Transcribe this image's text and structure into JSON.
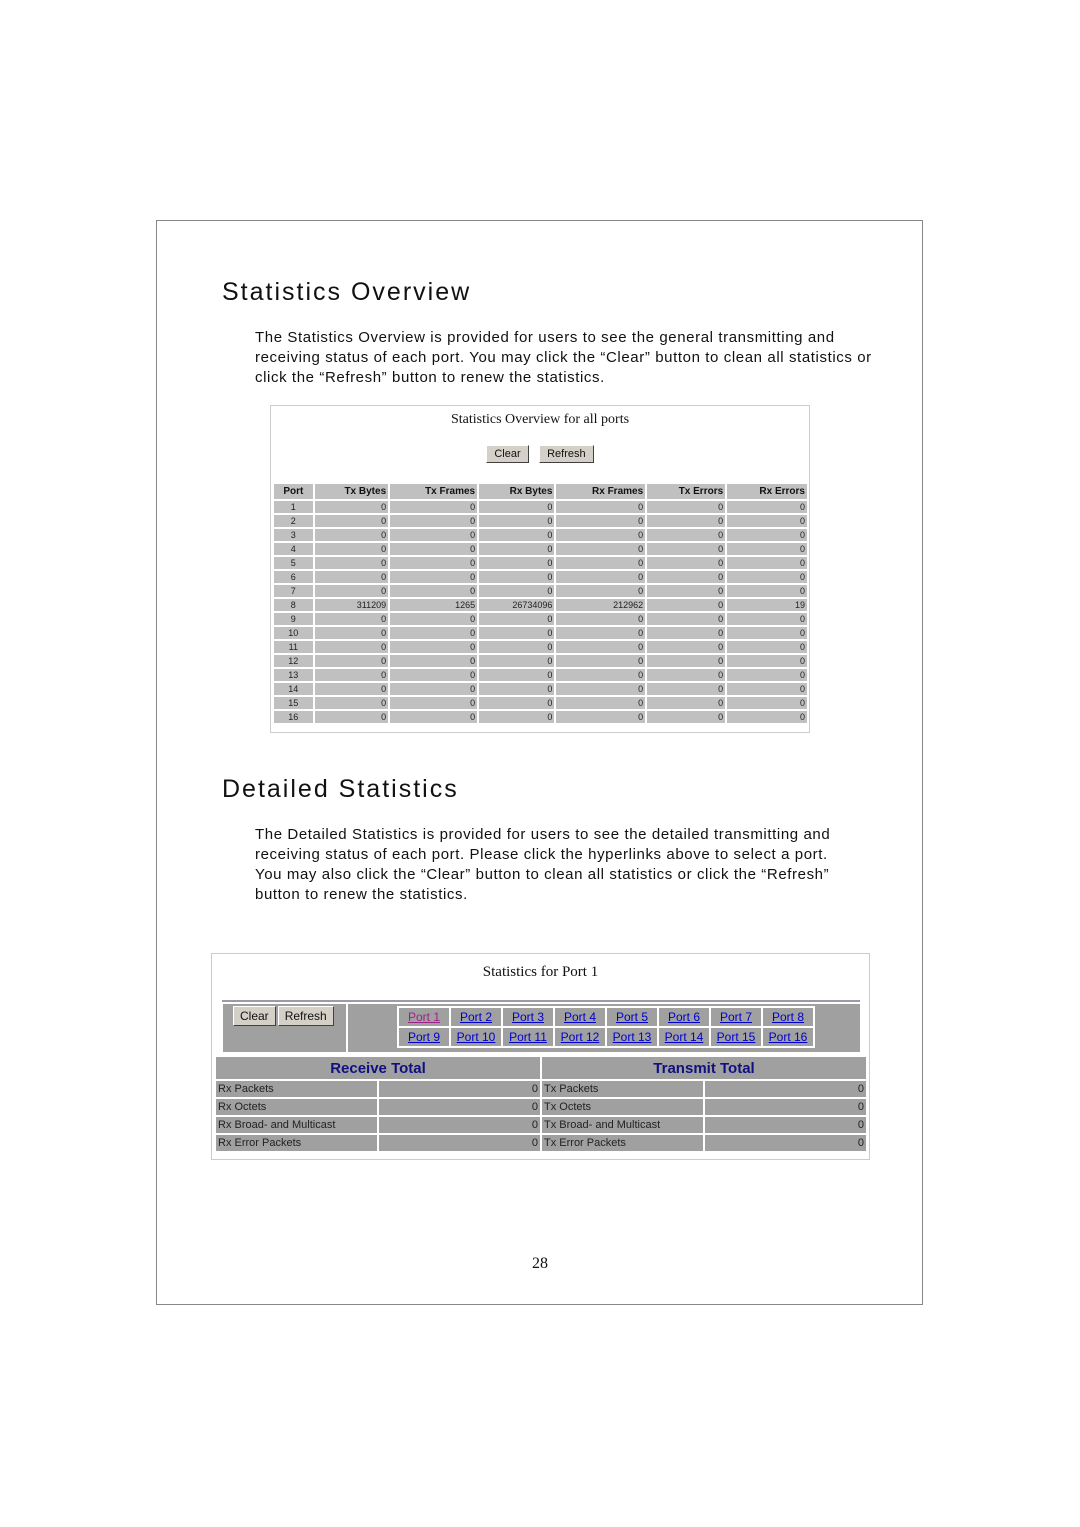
{
  "page_number": "28",
  "sections": [
    {
      "heading": "Statistics Overview",
      "paragraphs": [
        "The Statistics Overview is provided for users to see the general transmitting and receiving status of each port. You may click the “Clear” button to clean all statistics or click the “Refresh” button to renew the statistics."
      ]
    },
    {
      "heading": "Detailed Statistics",
      "paragraphs": [
        "The Detailed Statistics is provided for users to see the detailed transmitting and receiving status of each port. Please click the hyperlinks above to select a port.",
        "You may also click the “Clear” button to clean all statistics or click the “Refresh” button to renew the statistics."
      ]
    }
  ],
  "overview": {
    "title": "Statistics Overview for all ports",
    "clear_label": "Clear",
    "refresh_label": "Refresh",
    "columns": [
      "Port",
      "Tx Bytes",
      "Tx Frames",
      "Rx Bytes",
      "Rx Frames",
      "Tx Errors",
      "Rx Errors"
    ],
    "rows": [
      [
        "1",
        "0",
        "0",
        "0",
        "0",
        "0",
        "0"
      ],
      [
        "2",
        "0",
        "0",
        "0",
        "0",
        "0",
        "0"
      ],
      [
        "3",
        "0",
        "0",
        "0",
        "0",
        "0",
        "0"
      ],
      [
        "4",
        "0",
        "0",
        "0",
        "0",
        "0",
        "0"
      ],
      [
        "5",
        "0",
        "0",
        "0",
        "0",
        "0",
        "0"
      ],
      [
        "6",
        "0",
        "0",
        "0",
        "0",
        "0",
        "0"
      ],
      [
        "7",
        "0",
        "0",
        "0",
        "0",
        "0",
        "0"
      ],
      [
        "8",
        "311209",
        "1265",
        "26734096",
        "212962",
        "0",
        "19"
      ],
      [
        "9",
        "0",
        "0",
        "0",
        "0",
        "0",
        "0"
      ],
      [
        "10",
        "0",
        "0",
        "0",
        "0",
        "0",
        "0"
      ],
      [
        "11",
        "0",
        "0",
        "0",
        "0",
        "0",
        "0"
      ],
      [
        "12",
        "0",
        "0",
        "0",
        "0",
        "0",
        "0"
      ],
      [
        "13",
        "0",
        "0",
        "0",
        "0",
        "0",
        "0"
      ],
      [
        "14",
        "0",
        "0",
        "0",
        "0",
        "0",
        "0"
      ],
      [
        "15",
        "0",
        "0",
        "0",
        "0",
        "0",
        "0"
      ],
      [
        "16",
        "0",
        "0",
        "0",
        "0",
        "0",
        "0"
      ]
    ]
  },
  "detailed": {
    "title": "Statistics for Port 1",
    "clear_label": "Clear",
    "refresh_label": "Refresh",
    "selected_port": "Port 1",
    "port_links": [
      "Port 1",
      "Port 2",
      "Port 3",
      "Port 4",
      "Port 5",
      "Port 6",
      "Port 7",
      "Port 8",
      "Port 9",
      "Port 10",
      "Port 11",
      "Port 12",
      "Port 13",
      "Port 14",
      "Port 15",
      "Port 16"
    ],
    "receive_header": "Receive Total",
    "transmit_header": "Transmit Total",
    "rows": [
      {
        "rx_label": "Rx Packets",
        "rx_value": "0",
        "tx_label": "Tx Packets",
        "tx_value": "0"
      },
      {
        "rx_label": "Rx Octets",
        "rx_value": "0",
        "tx_label": "Tx Octets",
        "tx_value": "0"
      },
      {
        "rx_label": "Rx Broad- and Multicast",
        "rx_value": "0",
        "tx_label": "Tx Broad- and Multicast",
        "tx_value": "0"
      },
      {
        "rx_label": "Rx Error Packets",
        "rx_value": "0",
        "tx_label": "Tx Error Packets",
        "tx_value": "0"
      }
    ]
  }
}
